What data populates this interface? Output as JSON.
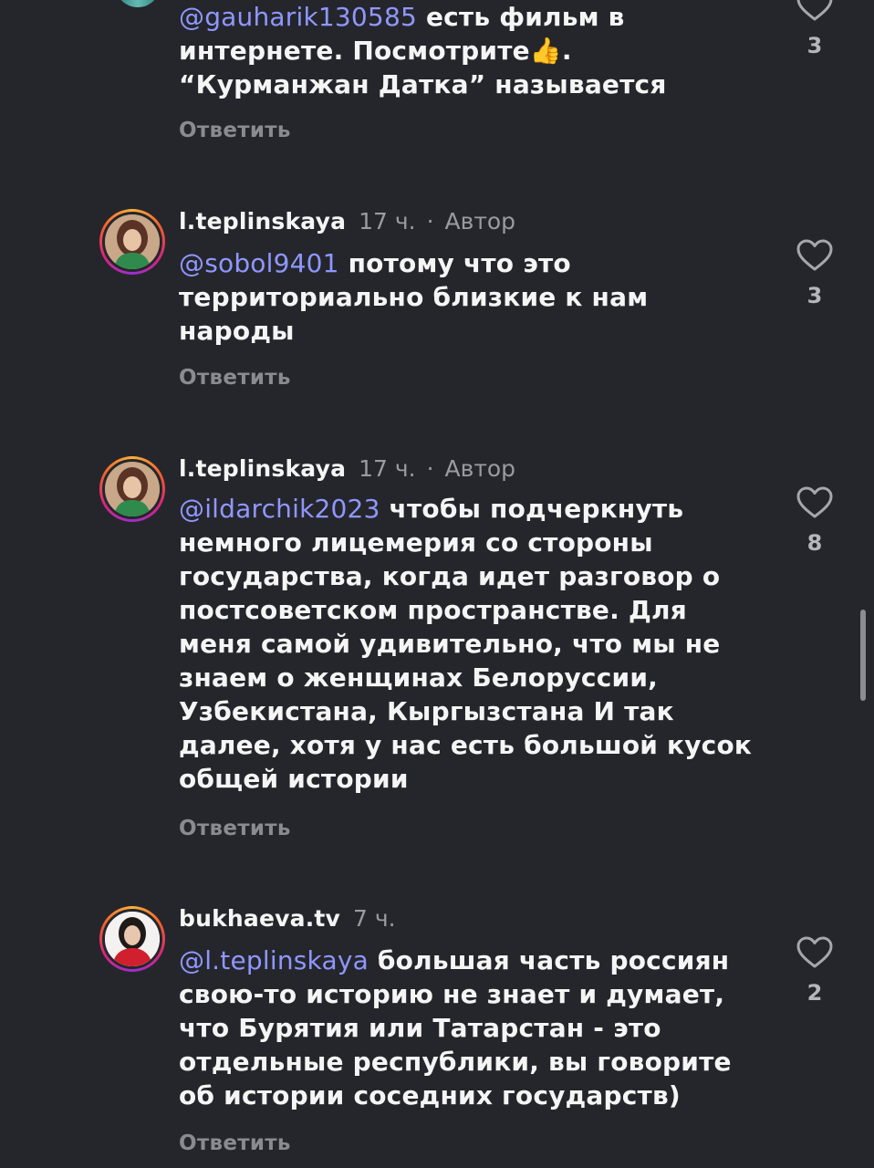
{
  "comments": [
    {
      "mention": "@gauharik130585",
      "text_lines": [
        "есть фильм в",
        "интернете. Посмотрите👍.",
        "“Курманжан Датка” называется"
      ],
      "reply_label": "Ответить",
      "likes": "3"
    },
    {
      "username": "l.teplinskaya",
      "time": "17 ч.",
      "separator": "·",
      "badge": "Автор",
      "mention": "@sobol9401",
      "text": "потому что это территориально близкие к нам народы",
      "reply_label": "Ответить",
      "likes": "3"
    },
    {
      "username": "l.teplinskaya",
      "time": "17 ч.",
      "separator": "·",
      "badge": "Автор",
      "mention": "@ildarchik2023",
      "text": "чтобы подчеркнуть немного лицемерия со стороны государства, когда идет разговор о постсоветском пространстве. Для меня самой удивительно, что мы не знаем о женщинах Белоруссии, Узбекистана, Кыргызстана И так далее, хотя у нас есть большой кусок общей истории",
      "reply_label": "Ответить",
      "likes": "8"
    },
    {
      "username": "bukhaeva.tv",
      "time": "7 ч.",
      "mention": "@l.teplinskaya",
      "text": "большая часть россиян свою-то историю не знает и думает, что Бурятия или Татарстан - это отдельные республики, вы говорите об истории соседних государств)",
      "reply_label": "Ответить",
      "likes": "2"
    }
  ],
  "colors": {
    "background": "#25262b",
    "mention": "#8f97ff",
    "muted": "#9a9ba1",
    "text": "#f5f5f5"
  },
  "icons": {
    "like": "heart-outline-icon"
  }
}
